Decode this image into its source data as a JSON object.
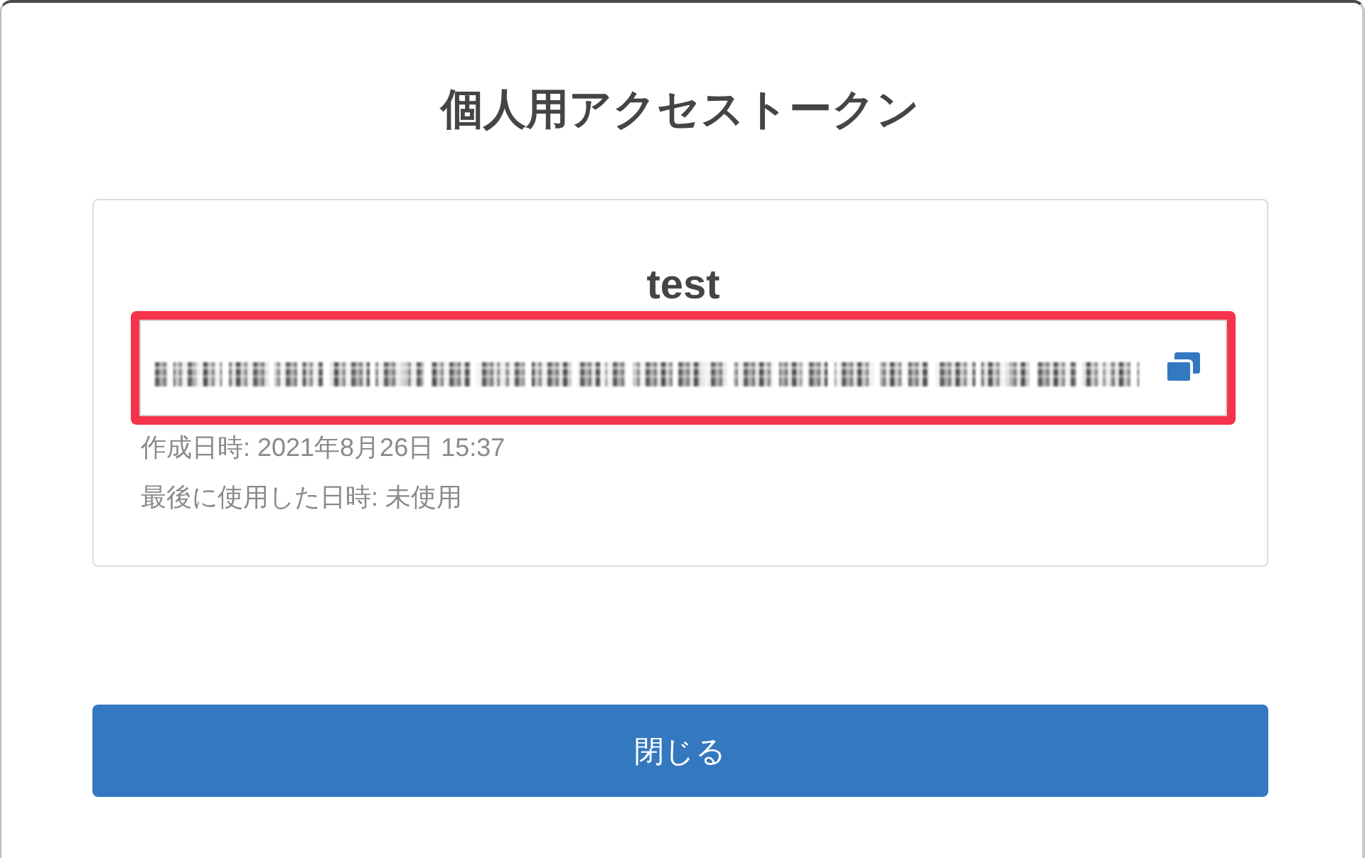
{
  "dialog": {
    "title": "個人用アクセストークン"
  },
  "token_card": {
    "name": "test",
    "token_field": {
      "highlighted": true
    },
    "created": "作成日時: 2021年8月26日 15:37",
    "last_used": "最後に使用した日時: 未使用"
  },
  "buttons": [
    {
      "label": "閉じる",
      "kind": "primary"
    }
  ]
}
